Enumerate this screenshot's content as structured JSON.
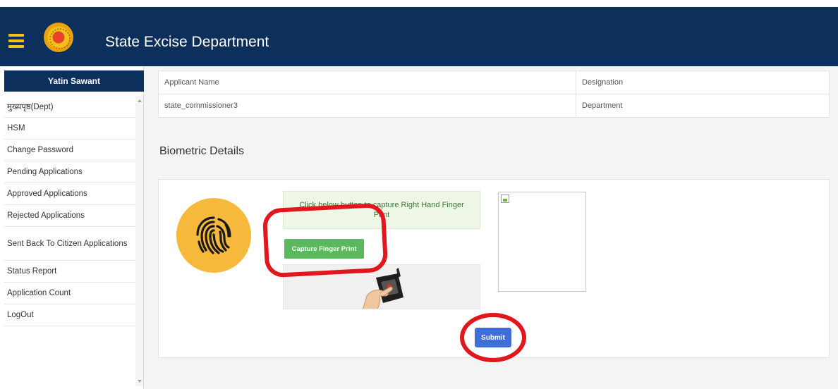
{
  "header": {
    "app_title": "State Excise Department",
    "brand_color": "#0c2f5c",
    "menu_icon": "hamburger-icon",
    "logo_icon": "emblem-icon"
  },
  "sidebar": {
    "user_name": "Yatin Sawant",
    "items": [
      {
        "label": "मुख्यपृष्ठ(Dept)"
      },
      {
        "label": "HSM"
      },
      {
        "label": "Change Password"
      },
      {
        "label": "Pending Applications"
      },
      {
        "label": "Approved Applications"
      },
      {
        "label": "Rejected Applications"
      },
      {
        "label": "Sent Back To Citizen Applications"
      },
      {
        "label": "Status Report"
      },
      {
        "label": "Application Count"
      },
      {
        "label": "LogOut"
      }
    ]
  },
  "info_table": {
    "rows": [
      [
        "Applicant Name",
        "Designation"
      ],
      [
        "state_commissioner3",
        "Department"
      ]
    ]
  },
  "biometric": {
    "section_title": "Biometric Details",
    "instruction": "Click below button to capture Right Hand Finger Print",
    "capture_label": "Capture Finger Print",
    "submit_label": "Submit",
    "success_color": "#5cb85c",
    "primary_color": "#3f6fd6",
    "annotation_color": "#e2161c"
  }
}
